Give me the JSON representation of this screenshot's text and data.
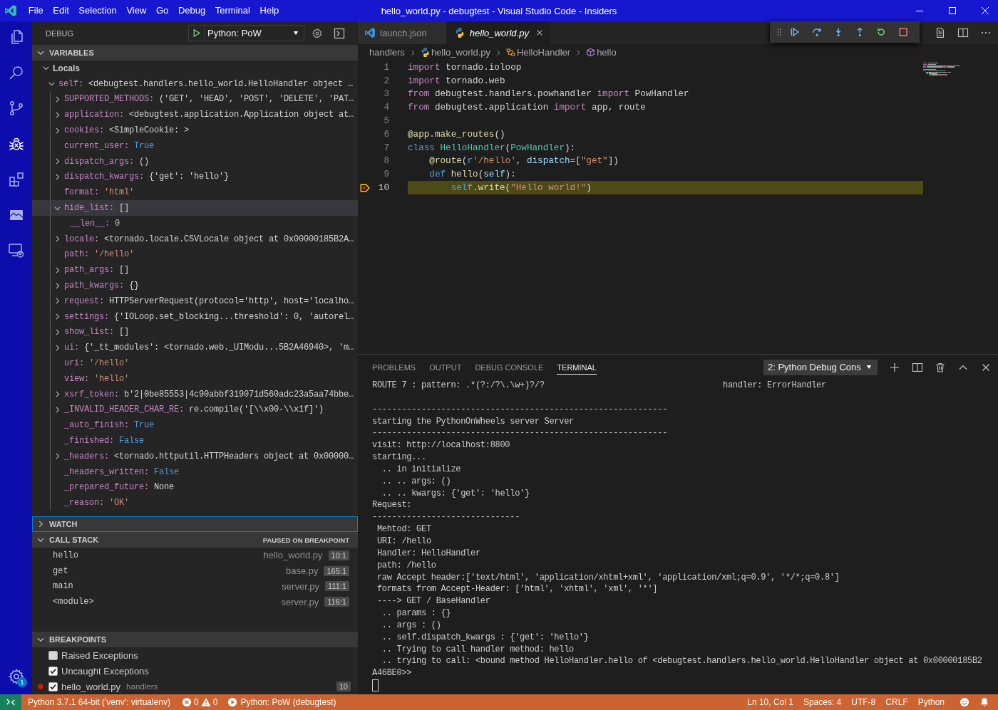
{
  "title_bar": {
    "menu": [
      "File",
      "Edit",
      "Selection",
      "View",
      "Go",
      "Debug",
      "Terminal",
      "Help"
    ],
    "title": "hello_world.py - debugtest - Visual Studio Code - Insiders"
  },
  "activity_bar": {
    "items": [
      {
        "selected": false
      },
      {
        "selected": false
      },
      {
        "selected": false
      },
      {
        "selected": true
      },
      {
        "selected": false
      },
      {
        "selected": false
      },
      {
        "selected": false
      }
    ],
    "manage_badge": "1"
  },
  "debug_sidebar": {
    "title": "DEBUG",
    "launch_config": "Python: PoW",
    "variables": {
      "title": "VARIABLES",
      "expanded": true,
      "scopes": [
        {
          "name": "Locals",
          "expanded": true,
          "selected": false,
          "children": [
            {
              "name": "self:",
              "value": "<debugtest.handlers.hello_world.HelloHandler object …",
              "kind": "object",
              "expanded": true,
              "selected": false,
              "children": [
                {
                  "name": "SUPPORTED_METHODS:",
                  "value": "('GET', 'HEAD', 'POST', 'DELETE', 'PAT…",
                  "kind": "object",
                  "expanded": false,
                  "selected": false
                },
                {
                  "name": "application:",
                  "value": "<debugtest.application.Application object at…",
                  "kind": "object",
                  "expanded": false,
                  "selected": false
                },
                {
                  "name": "cookies:",
                  "value": "<SimpleCookie: >",
                  "kind": "object",
                  "expanded": false,
                  "selected": false
                },
                {
                  "name": "current_user:",
                  "value": "True",
                  "kind": "boolean",
                  "selected": false
                },
                {
                  "name": "dispatch_args:",
                  "value": "()",
                  "kind": "object",
                  "expanded": false,
                  "selected": false
                },
                {
                  "name": "dispatch_kwargs:",
                  "value": "{'get': 'hello'}",
                  "kind": "object",
                  "expanded": false,
                  "selected": false
                },
                {
                  "name": "format:",
                  "value": "'html'",
                  "kind": "string",
                  "selected": false
                },
                {
                  "name": "hide_list:",
                  "value": "[]",
                  "kind": "object",
                  "expanded": true,
                  "selected": true,
                  "children": [
                    {
                      "name": "__len__:",
                      "value": "0",
                      "kind": "number",
                      "selected": false
                    }
                  ]
                },
                {
                  "name": "locale:",
                  "value": "<tornado.locale.CSVLocale object at 0x00000185B2A…",
                  "kind": "object",
                  "expanded": false,
                  "selected": false
                },
                {
                  "name": "path:",
                  "value": "'/hello'",
                  "kind": "string",
                  "selected": false
                },
                {
                  "name": "path_args:",
                  "value": "[]",
                  "kind": "object",
                  "expanded": false,
                  "selected": false
                },
                {
                  "name": "path_kwargs:",
                  "value": "{}",
                  "kind": "object",
                  "expanded": false,
                  "selected": false
                },
                {
                  "name": "request:",
                  "value": "HTTPServerRequest(protocol='http', host='localho…",
                  "kind": "object",
                  "expanded": false,
                  "selected": false
                },
                {
                  "name": "settings:",
                  "value": "{'IOLoop.set_blocking...threshold': 0, 'autorel…",
                  "kind": "object",
                  "expanded": false,
                  "selected": false
                },
                {
                  "name": "show_list:",
                  "value": "[]",
                  "kind": "object",
                  "expanded": false,
                  "selected": false
                },
                {
                  "name": "ui:",
                  "value": "{'_tt_modules': <tornado.web._UIModu...5B2A46940>, 'm…",
                  "kind": "object",
                  "expanded": false,
                  "selected": false
                },
                {
                  "name": "uri:",
                  "value": "'/hello'",
                  "kind": "string",
                  "selected": false
                },
                {
                  "name": "view:",
                  "value": "'hello'",
                  "kind": "string",
                  "selected": false
                },
                {
                  "name": "xsrf_token:",
                  "value": "b'2|0be85553|4c90abbf319071d560adc23a5aa74bbe…",
                  "kind": "object",
                  "expanded": false,
                  "selected": false
                },
                {
                  "name": "_INVALID_HEADER_CHAR_RE:",
                  "value": "re.compile('[\\\\x00-\\\\x1f]')",
                  "kind": "object",
                  "expanded": false,
                  "selected": false
                },
                {
                  "name": "_auto_finish:",
                  "value": "True",
                  "kind": "boolean",
                  "selected": false
                },
                {
                  "name": "_finished:",
                  "value": "False",
                  "kind": "boolean",
                  "selected": false
                },
                {
                  "name": "_headers:",
                  "value": "<tornado.httputil.HTTPHeaders object at 0x00000…",
                  "kind": "object",
                  "expanded": false,
                  "selected": false
                },
                {
                  "name": "_headers_written:",
                  "value": "False",
                  "kind": "boolean",
                  "selected": false
                },
                {
                  "name": "_prepared_future:",
                  "value": "None",
                  "kind": "object",
                  "selected": false
                },
                {
                  "name": "_reason:",
                  "value": "'OK'",
                  "kind": "string",
                  "selected": false
                }
              ]
            }
          ]
        }
      ]
    },
    "watch": {
      "title": "WATCH",
      "expanded": false,
      "focused": true
    },
    "call_stack": {
      "title": "CALL STACK",
      "expanded": true,
      "status": "PAUSED ON BREAKPOINT",
      "frames": [
        {
          "name": "hello",
          "file": "hello_world.py",
          "position": "10:1"
        },
        {
          "name": "get",
          "file": "base.py",
          "position": "165:1"
        },
        {
          "name": "main",
          "file": "server.py",
          "position": "111:1"
        },
        {
          "name": "<module>",
          "file": "server.py",
          "position": "116:1"
        }
      ]
    },
    "breakpoints": {
      "title": "BREAKPOINTS",
      "expanded": true,
      "items": [
        {
          "kind": "exception",
          "label": "Raised Exceptions",
          "checked": false
        },
        {
          "kind": "exception",
          "label": "Uncaught Exceptions",
          "checked": true
        },
        {
          "kind": "source",
          "label": "hello_world.py",
          "folder": "handlers",
          "line": "10",
          "checked": true
        }
      ]
    }
  },
  "editor": {
    "tabs": [
      {
        "label": "launch.json",
        "kind": "config",
        "selected": false,
        "preview": false
      },
      {
        "label": "hello_world.py",
        "kind": "python",
        "selected": true,
        "preview": true
      }
    ],
    "breadcrumbs": [
      {
        "label": "handlers",
        "kind": "folder"
      },
      {
        "label": "hello_world.py",
        "kind": "python"
      },
      {
        "label": "HelloHandler",
        "kind": "class"
      },
      {
        "label": "hello",
        "kind": "method"
      }
    ],
    "lines": [
      {
        "number": "1",
        "current": false,
        "breakpoint": false,
        "tokens": [
          {
            "text": "import",
            "kind": "keyword"
          },
          {
            "text": " tornado.ioloop",
            "kind": "plain"
          }
        ]
      },
      {
        "number": "2",
        "current": false,
        "breakpoint": false,
        "tokens": [
          {
            "text": "import",
            "kind": "keyword"
          },
          {
            "text": " tornado.web",
            "kind": "plain"
          }
        ]
      },
      {
        "number": "3",
        "current": false,
        "breakpoint": false,
        "tokens": [
          {
            "text": "from",
            "kind": "keyword"
          },
          {
            "text": " debugtest.handlers.powhandler ",
            "kind": "plain"
          },
          {
            "text": "import",
            "kind": "keyword"
          },
          {
            "text": " PowHandler",
            "kind": "plain"
          }
        ]
      },
      {
        "number": "4",
        "current": false,
        "breakpoint": false,
        "tokens": [
          {
            "text": "from",
            "kind": "keyword"
          },
          {
            "text": " debugtest.application ",
            "kind": "plain"
          },
          {
            "text": "import",
            "kind": "keyword"
          },
          {
            "text": " app, route",
            "kind": "plain"
          }
        ]
      },
      {
        "number": "5",
        "current": false,
        "breakpoint": false
      },
      {
        "number": "6",
        "current": false,
        "breakpoint": false,
        "tokens": [
          {
            "text": "@app.make_routes",
            "kind": "function"
          },
          {
            "text": "()",
            "kind": "plain"
          }
        ]
      },
      {
        "number": "7",
        "current": false,
        "breakpoint": false,
        "tokens": [
          {
            "text": "class",
            "kind": "storage"
          },
          {
            "text": " HelloHandler",
            "kind": "class"
          },
          {
            "text": "(",
            "kind": "plain"
          },
          {
            "text": "PowHandler",
            "kind": "class"
          },
          {
            "text": "):",
            "kind": "plain"
          }
        ]
      },
      {
        "number": "8",
        "current": false,
        "breakpoint": false,
        "tokens": [
          {
            "text": "    @route",
            "kind": "function"
          },
          {
            "text": "(",
            "kind": "plain"
          },
          {
            "text": "r",
            "kind": "storage"
          },
          {
            "text": "'/hello'",
            "kind": "string"
          },
          {
            "text": ", ",
            "kind": "plain"
          },
          {
            "text": "dispatch",
            "kind": "parameter"
          },
          {
            "text": "=[",
            "kind": "plain"
          },
          {
            "text": "\"get\"",
            "kind": "string"
          },
          {
            "text": "])",
            "kind": "plain"
          }
        ]
      },
      {
        "number": "9",
        "current": false,
        "breakpoint": false,
        "tokens": [
          {
            "text": "    def",
            "kind": "storage"
          },
          {
            "text": " hello",
            "kind": "function"
          },
          {
            "text": "(",
            "kind": "plain"
          },
          {
            "text": "self",
            "kind": "parameter"
          },
          {
            "text": "):",
            "kind": "plain"
          }
        ]
      },
      {
        "number": "10",
        "current": true,
        "breakpoint": true,
        "tokens": [
          {
            "text": "        self",
            "kind": "storage"
          },
          {
            "text": ".",
            "kind": "plain"
          },
          {
            "text": "write",
            "kind": "function"
          },
          {
            "text": "(",
            "kind": "plain"
          },
          {
            "text": "\"Hello world!\"",
            "kind": "string"
          },
          {
            "text": ")",
            "kind": "plain"
          }
        ]
      }
    ]
  },
  "panel": {
    "tabs": [
      {
        "label": "PROBLEMS",
        "selected": false
      },
      {
        "label": "OUTPUT",
        "selected": false
      },
      {
        "label": "DEBUG CONSOLE",
        "selected": false
      },
      {
        "label": "TERMINAL",
        "selected": true
      }
    ],
    "terminal_selector": "2: Python Debug Cons",
    "terminal": {
      "blocks": [
        [
          {
            "text": "ROUTE 7 : pattern: .*(?:/?\\.\\w+)?/?",
            "column_2": "handler: ErrorHandler"
          }
        ],
        [
          {
            "text": "------------------------------------------------------------"
          },
          {
            "text": "starting the PythonOnWheels server Server"
          },
          {
            "text": "------------------------------------------------------------"
          },
          {
            "text": "visit: http://localhost:8800"
          },
          {
            "text": "starting..."
          },
          {
            "text": "  .. in initialize"
          },
          {
            "text": "  .. .. args: ()"
          },
          {
            "text": "  .. .. kwargs: {'get': 'hello'}"
          },
          {
            "text": "Request:"
          },
          {
            "text": "------------------------------"
          },
          {
            "text": " Mehtod: GET"
          },
          {
            "text": " URI: /hello"
          },
          {
            "text": " Handler: HelloHandler"
          },
          {
            "text": " path: /hello"
          },
          {
            "text": " raw Accept header:['text/html', 'application/xhtml+xml', 'application/xml;q=0.9', '*/*;q=0.8']"
          },
          {
            "text": " formats from Accept-Header: ['html', 'xhtml', 'xml', '*']"
          },
          {
            "text": " ----> GET / BaseHandler"
          },
          {
            "text": "  .. params : {}"
          },
          {
            "text": "  .. args : ()"
          },
          {
            "text": "  .. self.dispatch_kwargs : {'get': 'hello'}"
          },
          {
            "text": "  .. Trying to call handler method: hello"
          },
          {
            "text": "  .. trying to call: <bound method HelloHandler.hello of <debugtest.handlers.hello_world.HelloHandler object at 0x00000185B2"
          },
          {
            "text": "A46BE0>>"
          }
        ]
      ]
    }
  },
  "status_bar": {
    "interpreter": "Python 3.7.1 64-bit ('venv': virtualenv)",
    "errors": "0",
    "warnings": "0",
    "debug_session": "Python: PoW (debugtest)",
    "cursor": "Ln 10, Col 1",
    "indentation": "Spaces: 4",
    "encoding": "UTF-8",
    "line_endings": "CRLF",
    "language": "Python"
  }
}
